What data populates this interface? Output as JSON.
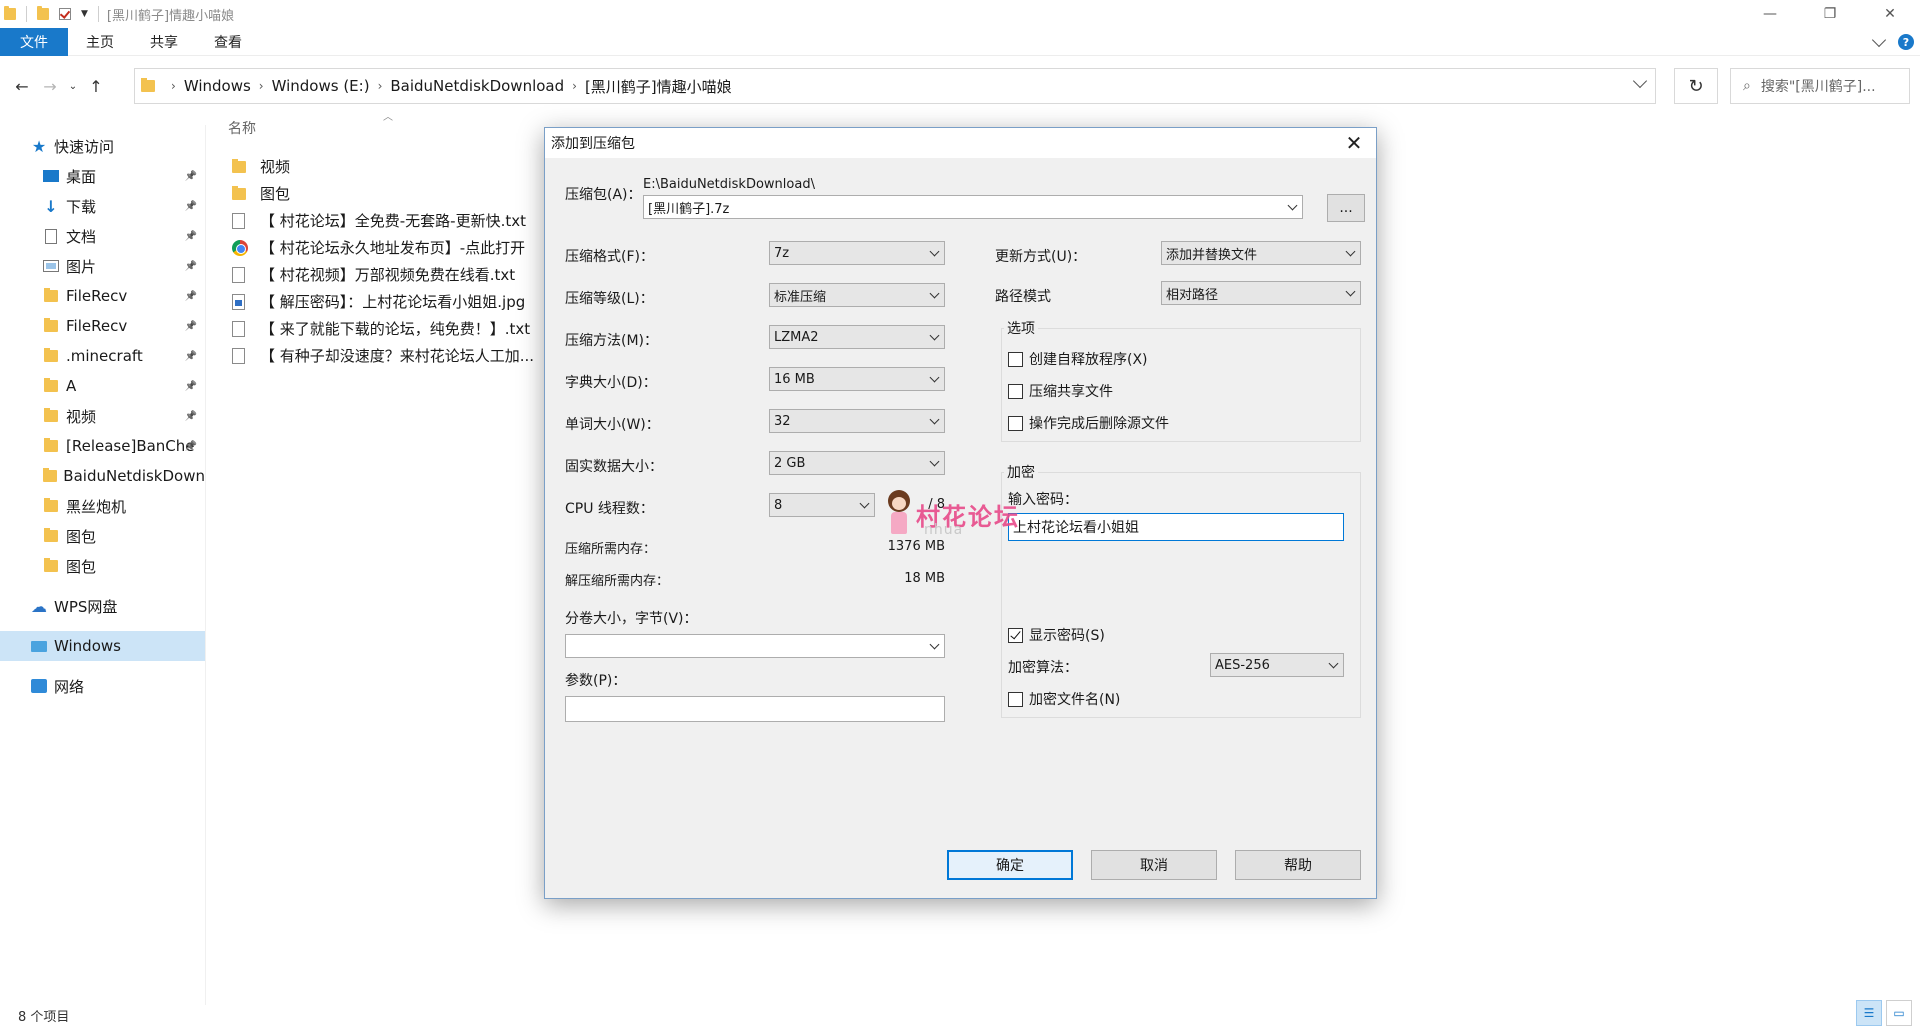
{
  "window": {
    "title": "[黑川鹤子]情趣小喵娘",
    "ribbon_tabs": [
      "文件",
      "主页",
      "共享",
      "查看"
    ]
  },
  "address": {
    "crumbs": [
      "Windows",
      "Windows (E:)",
      "BaiduNetdiskDownload",
      "[黑川鹤子]情趣小喵娘"
    ],
    "search_placeholder": "搜索\"[黑川鹤子]..."
  },
  "nav": {
    "quick_access": "快速访问",
    "items": [
      {
        "label": "桌面",
        "icon": "desktop-icon",
        "pinned": true
      },
      {
        "label": "下载",
        "icon": "download-icon",
        "pinned": true
      },
      {
        "label": "文档",
        "icon": "document-icon",
        "pinned": true
      },
      {
        "label": "图片",
        "icon": "pictures-icon",
        "pinned": true
      },
      {
        "label": "FileRecv",
        "icon": "folder-icon",
        "pinned": true
      },
      {
        "label": "FileRecv",
        "icon": "folder-icon",
        "pinned": true
      },
      {
        "label": ".minecraft",
        "icon": "folder-icon",
        "pinned": true
      },
      {
        "label": "A",
        "icon": "folder-icon",
        "pinned": true
      },
      {
        "label": "视频",
        "icon": "folder-icon",
        "pinned": true
      },
      {
        "label": "[Release]BanChe",
        "icon": "folder-icon",
        "pinned": true
      },
      {
        "label": "BaiduNetdiskDown",
        "icon": "folder-icon",
        "pinned": false
      },
      {
        "label": "黑丝炮机",
        "icon": "folder-icon",
        "pinned": false
      },
      {
        "label": "图包",
        "icon": "folder-icon",
        "pinned": false
      },
      {
        "label": "图包",
        "icon": "folder-icon",
        "pinned": false
      }
    ],
    "wps": "WPS网盘",
    "windows": "Windows",
    "network": "网络"
  },
  "list": {
    "col_name": "名称",
    "files": [
      {
        "name": "视频",
        "type": "folder"
      },
      {
        "name": "图包",
        "type": "folder"
      },
      {
        "name": "【 村花论坛】全免费-无套路-更新快.txt",
        "type": "txt"
      },
      {
        "name": "【 村花论坛永久地址发布页】-点此打开",
        "type": "chrome"
      },
      {
        "name": "【 村花视频】万部视频免费在线看.txt",
        "type": "txt"
      },
      {
        "name": "【 解压密码】：上村花论坛看小姐姐.jpg",
        "type": "jpg"
      },
      {
        "name": "【 来了就能下载的论坛，纯免费！】.txt",
        "type": "txt"
      },
      {
        "name": "【 有种子却没速度？来村花论坛人工加...",
        "type": "txt"
      }
    ],
    "status": "8 个项目"
  },
  "dialog": {
    "title": "添加到压缩包",
    "archive_label": "压缩包(A)：",
    "archive_path": "E:\\BaiduNetdiskDownload\\",
    "archive_name": "[黑川鹤子].7z",
    "browse": "...",
    "format_label": "压缩格式(F)：",
    "format_value": "7z",
    "level_label": "压缩等级(L)：",
    "level_value": "标准压缩",
    "method_label": "压缩方法(M)：",
    "method_value": "LZMA2",
    "dict_label": "字典大小(D)：",
    "dict_value": "16 MB",
    "word_label": "单词大小(W)：",
    "word_value": "32",
    "solid_label": "固实数据大小：",
    "solid_value": "2 GB",
    "threads_label": "CPU 线程数：",
    "threads_value": "8",
    "threads_total": "/ 8",
    "mem_comp_label": "压缩所需内存：",
    "mem_comp_value": "1376 MB",
    "mem_decomp_label": "解压缩所需内存：",
    "mem_decomp_value": "18 MB",
    "split_label": "分卷大小，字节(V)：",
    "split_value": "",
    "params_label": "参数(P)：",
    "params_value": "",
    "update_label": "更新方式(U)：",
    "update_value": "添加并替换文件",
    "path_label": "路径模式",
    "path_value": "相对路径",
    "options_title": "选项",
    "opt_sfx": "创建自释放程序(X)",
    "opt_shared": "压缩共享文件",
    "opt_delete": "操作完成后删除源文件",
    "enc_title": "加密",
    "pwd_label": "输入密码：",
    "pwd_value": "上村花论坛看小姐姐",
    "show_pwd": "显示密码(S)",
    "enc_method_label": "加密算法：",
    "enc_method_value": "AES-256",
    "enc_names": "加密文件名(N)",
    "ok": "确定",
    "cancel": "取消",
    "help": "帮助"
  },
  "watermark": {
    "text": "村花论坛",
    "sub": "nhua"
  }
}
